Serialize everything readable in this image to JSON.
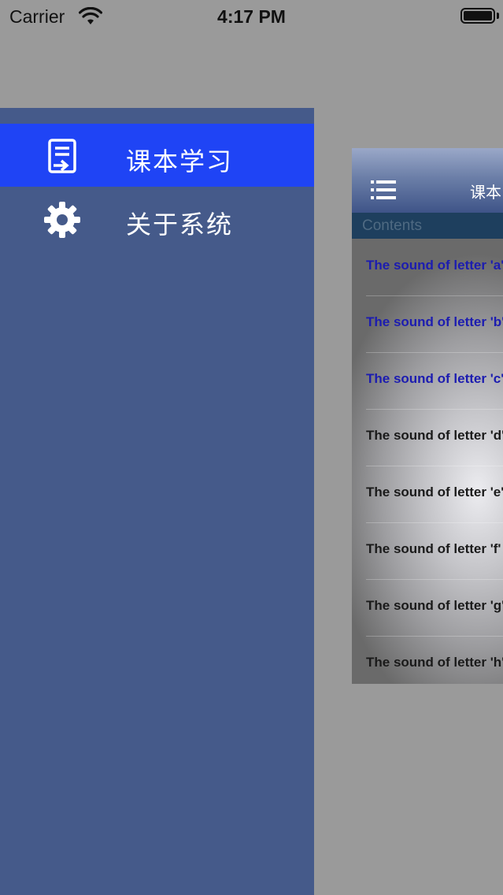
{
  "status_bar": {
    "carrier": "Carrier",
    "time": "4:17 PM"
  },
  "side_menu": {
    "items": [
      {
        "label": "课本学习",
        "icon": "book-icon",
        "selected": true
      },
      {
        "label": "关于系统",
        "icon": "gear-icon",
        "selected": false
      }
    ]
  },
  "content_panel": {
    "title": "课本",
    "section_header": "Contents",
    "rows": [
      {
        "text": "The sound of letter 'a'",
        "color": "#1c1cb0"
      },
      {
        "text": "The sound of letter 'b'",
        "color": "#1c1cb0"
      },
      {
        "text": "The sound of letter 'c'",
        "color": "#1c1cb0"
      },
      {
        "text": "The sound of letter 'd'",
        "color": "#1a1a1a"
      },
      {
        "text": "The sound of letter 'e'",
        "color": "#1a1a1a"
      },
      {
        "text": "The sound of letter 'f'",
        "color": "#1a1a1a"
      },
      {
        "text": "The sound of letter 'g'",
        "color": "#1a1a1a"
      },
      {
        "text": "The sound of letter 'h'",
        "color": "#1a1a1a"
      }
    ]
  },
  "colors": {
    "menu_background": "#455a8a",
    "menu_selected": "#1f44f5",
    "dim_overlay": "#9a9a9a"
  }
}
